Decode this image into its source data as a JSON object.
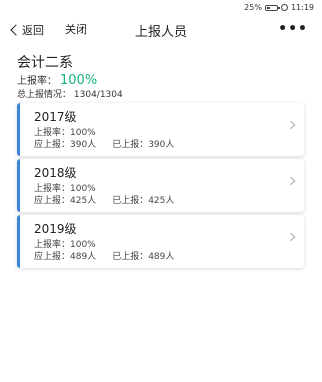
{
  "status_bar": {
    "battery": "25%",
    "time": "11:19"
  },
  "nav": {
    "back_label": "返回",
    "close_label": "关闭",
    "title": "上报人员",
    "more": "•••"
  },
  "summary": {
    "dept_name": "会计二系",
    "rate_label": "上报率：",
    "rate_value": "100%",
    "total_label": "总上报情况：",
    "total_value": "1304/1304"
  },
  "grades": [
    {
      "title": "2017级",
      "rate": "上报率：100%",
      "expected": "应上报：390人",
      "reported": "已上报：390人"
    },
    {
      "title": "2018级",
      "rate": "上报率：100%",
      "expected": "应上报：425人",
      "reported": "已上报：425人"
    },
    {
      "title": "2019级",
      "rate": "上报率：100%",
      "expected": "应上报：489人",
      "reported": "已上报：489人"
    }
  ]
}
